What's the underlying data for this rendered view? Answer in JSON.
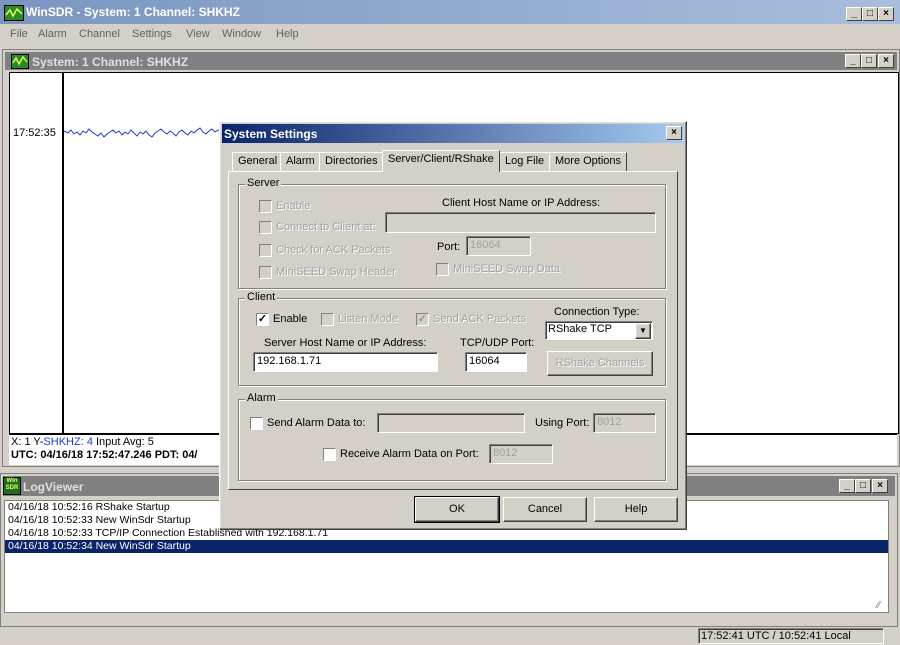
{
  "app": {
    "title": "WinSDR - System: 1 Channel: SHKHZ",
    "menu": [
      "File",
      "Alarm",
      "Channel",
      "Settings",
      "View",
      "Window",
      "Help"
    ],
    "caption_buttons": {
      "min": "_",
      "max": "□",
      "close": "×"
    }
  },
  "channel_window": {
    "title": "System: 1 Channel: SHKHZ",
    "time_label": "17:52:35",
    "status_line1": {
      "prefix": "X: 1  Y-",
      "channel": "SHKHZ: 4",
      "suffix": "  Input Avg: 5"
    },
    "status_line2": "UTC: 04/16/18 17:52:47.246  PDT: 04/"
  },
  "log_viewer": {
    "title": "LogViewer",
    "icon_text": "Win SDR",
    "lines": [
      "04/16/18 10:52:16 RShake Startup",
      "04/16/18 10:52:33 New WinSdr Startup",
      "04/16/18 10:52:33 TCP/IP Connection Established with 192.168.1.71",
      "04/16/18 10:52:34 New WinSdr Startup"
    ],
    "selected_index": 3
  },
  "status_bar": {
    "time": "17:52:41 UTC / 10:52:41 Local"
  },
  "dialog": {
    "title": "System Settings",
    "tabs": [
      "General",
      "Alarm",
      "Directories",
      "Server/Client/RShake",
      "Log File",
      "More Options"
    ],
    "active_tab": 3,
    "server": {
      "group": "Server",
      "enable": "Enable",
      "connect_to_client": "Connect to Client at:",
      "client_host_label": "Client Host Name or IP Address:",
      "client_host_value": "",
      "check_ack": "Check for ACK Packets",
      "port_label": "Port:",
      "port_value": "16064",
      "miniseed_header": "MiniSEED Swap Header",
      "miniseed_data": "MiniSEED Swap Data"
    },
    "client": {
      "group": "Client",
      "enable": "Enable",
      "enable_checked": true,
      "listen_mode": "Listen Mode",
      "send_ack": "Send ACK Packets",
      "connection_type_label": "Connection Type:",
      "connection_type_value": "RShake TCP",
      "server_host_label": "Server Host Name or IP Address:",
      "server_host_value": "192.168.1.71",
      "port_label": "TCP/UDP Port:",
      "port_value": "16064",
      "rshake_channels": "RShake Channels"
    },
    "alarm": {
      "group": "Alarm",
      "send_alarm": "Send Alarm Data to:",
      "send_alarm_value": "",
      "using_port_label": "Using Port:",
      "using_port_value": "8012",
      "receive_alarm": "Receive Alarm Data on Port:",
      "receive_port_value": "8012"
    },
    "buttons": {
      "ok": "OK",
      "cancel": "Cancel",
      "help": "Help"
    }
  },
  "colors": {
    "active_title": "#0a246a",
    "inactive_title": "#808080",
    "waveform": "#1a3fcc",
    "selection": "#0a246a"
  }
}
